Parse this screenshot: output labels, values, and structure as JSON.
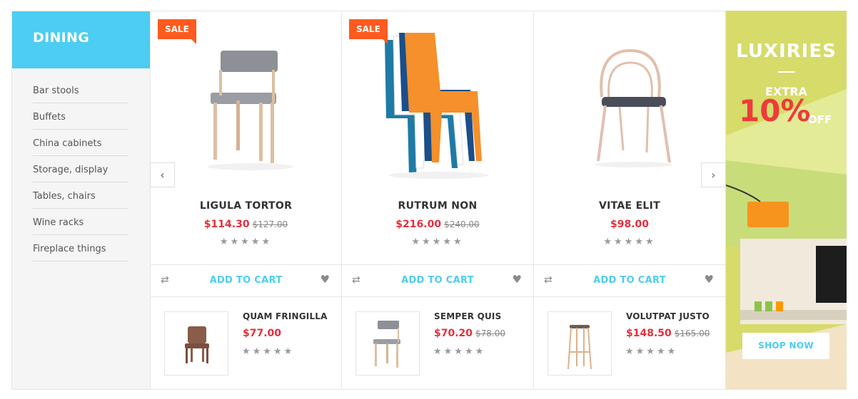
{
  "sidebar": {
    "title": "DINING",
    "items": [
      {
        "label": "Bar stools"
      },
      {
        "label": "Buffets"
      },
      {
        "label": "China cabinets"
      },
      {
        "label": "Storage, display"
      },
      {
        "label": "Tables, chairs"
      },
      {
        "label": "Wine racks"
      },
      {
        "label": "Fireplace things"
      }
    ]
  },
  "products": [
    {
      "badge": "SALE",
      "name": "LIGULA TORTOR",
      "price": "$114.30",
      "old_price": "$127.00",
      "rating": 0,
      "image": "grey-seat-chair-icon"
    },
    {
      "badge": "SALE",
      "name": "RUTRUM NON",
      "price": "$216.00",
      "old_price": "$240.00",
      "rating": 0,
      "image": "stacked-plastic-chairs-icon"
    },
    {
      "badge": "",
      "name": "VITAE ELIT",
      "price": "$98.00",
      "old_price": "",
      "rating": 0,
      "image": "bentwood-chair-icon"
    }
  ],
  "actions": {
    "add_to_cart": "ADD TO CART"
  },
  "mini_products": [
    {
      "name": "QUAM FRINGILLA",
      "price": "$77.00",
      "old_price": "",
      "rating": 0,
      "image": "wooden-armchair-icon"
    },
    {
      "name": "SEMPER QUIS",
      "price": "$70.20",
      "old_price": "$78.00",
      "rating": 0,
      "image": "grey-seat-chair-icon"
    },
    {
      "name": "VOLUTPAT JUSTO",
      "price": "$148.50",
      "old_price": "$165.00",
      "rating": 0,
      "image": "bar-stool-icon"
    }
  ],
  "nav": {
    "prev_icon": "chevron-left-icon",
    "next_icon": "chevron-right-icon"
  },
  "banner": {
    "title": "LUXIRIES",
    "extra": "EXTRA",
    "percent": "10%",
    "off": "OFF",
    "button": "SHOP NOW"
  },
  "colors": {
    "accent": "#4ccdf1",
    "sale_badge": "#ff5a1f",
    "price": "#e62e3a",
    "star": "#9a9a9a"
  },
  "stars_glyph": "★★★★★"
}
